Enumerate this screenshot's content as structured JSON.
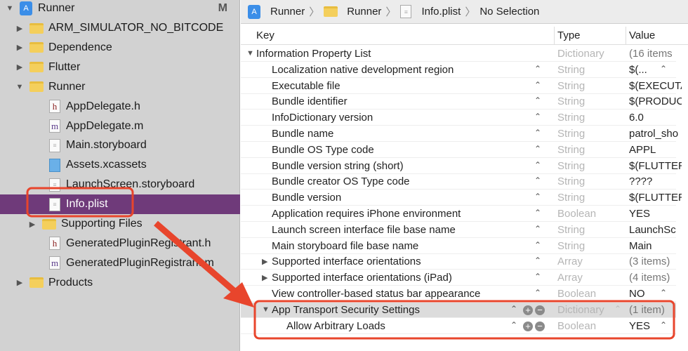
{
  "sidebar": {
    "root": {
      "label": "Runner",
      "badge": "M"
    },
    "items": [
      {
        "label": "ARM_SIMULATOR_NO_BITCODE",
        "kind": "folder",
        "disclosure": "collapsed"
      },
      {
        "label": "Dependence",
        "kind": "folder",
        "disclosure": "collapsed"
      },
      {
        "label": "Flutter",
        "kind": "folder",
        "disclosure": "collapsed"
      },
      {
        "label": "Runner",
        "kind": "folder",
        "disclosure": "expanded"
      },
      {
        "label": "AppDelegate.h",
        "kind": "h"
      },
      {
        "label": "AppDelegate.m",
        "kind": "m"
      },
      {
        "label": "Main.storyboard",
        "kind": "file"
      },
      {
        "label": "Assets.xcassets",
        "kind": "assets"
      },
      {
        "label": "LaunchScreen.storyboard",
        "kind": "file"
      },
      {
        "label": "Info.plist",
        "kind": "file",
        "selected": true
      },
      {
        "label": "Supporting Files",
        "kind": "folder",
        "disclosure": "collapsed"
      },
      {
        "label": "GeneratedPluginRegistrant.h",
        "kind": "h"
      },
      {
        "label": "GeneratedPluginRegistrant.m",
        "kind": "m"
      },
      {
        "label": "Products",
        "kind": "folder",
        "disclosure": "collapsed",
        "top": true
      }
    ]
  },
  "breadcrumb": [
    "Runner",
    "Runner",
    "Info.plist",
    "No Selection"
  ],
  "columns": {
    "key": "Key",
    "type": "Type",
    "value": "Value"
  },
  "rows": [
    {
      "key": "Information Property List",
      "type": "Dictionary",
      "value": "(16 items",
      "disclosure": "expanded",
      "level": 0
    },
    {
      "key": "Localization native development region",
      "type": "String",
      "value": "$(...",
      "level": 1
    },
    {
      "key": "Executable file",
      "type": "String",
      "value": "$(EXECUTABLE_NAME)",
      "level": 1
    },
    {
      "key": "Bundle identifier",
      "type": "String",
      "value": "$(PRODUCT_BUNDLE_IDENTIFIER)",
      "level": 1
    },
    {
      "key": "InfoDictionary version",
      "type": "String",
      "value": "6.0",
      "level": 1
    },
    {
      "key": "Bundle name",
      "type": "String",
      "value": "patrol_sho",
      "level": 1
    },
    {
      "key": "Bundle OS Type code",
      "type": "String",
      "value": "APPL",
      "level": 1
    },
    {
      "key": "Bundle version string (short)",
      "type": "String",
      "value": "$(FLUTTER",
      "level": 1
    },
    {
      "key": "Bundle creator OS Type code",
      "type": "String",
      "value": "????",
      "level": 1
    },
    {
      "key": "Bundle version",
      "type": "String",
      "value": "$(FLUTTER",
      "level": 1
    },
    {
      "key": "Application requires iPhone environment",
      "type": "Boolean",
      "value": "YES",
      "level": 1
    },
    {
      "key": "Launch screen interface file base name",
      "type": "String",
      "value": "LaunchSc",
      "level": 1
    },
    {
      "key": "Main storyboard file base name",
      "type": "String",
      "value": "Main",
      "level": 1
    },
    {
      "key": "Supported interface orientations",
      "type": "Array",
      "value": "(3 items)",
      "disclosure": "collapsed",
      "level": 1
    },
    {
      "key": "Supported interface orientations (iPad)",
      "type": "Array",
      "value": "(4 items)",
      "disclosure": "collapsed",
      "level": 1
    },
    {
      "key": "View controller-based status bar appearance",
      "type": "Boolean",
      "value": "NO",
      "level": 1
    },
    {
      "key": "App Transport Security Settings",
      "type": "Dictionary",
      "value": "(1 item)",
      "disclosure": "expanded",
      "level": 1,
      "highlighted": true
    },
    {
      "key": "Allow Arbitrary Loads",
      "type": "Boolean",
      "value": "YES",
      "level": 2
    }
  ],
  "colors": {
    "selection": "#6f3a7a",
    "annotation": "#e8452c"
  }
}
